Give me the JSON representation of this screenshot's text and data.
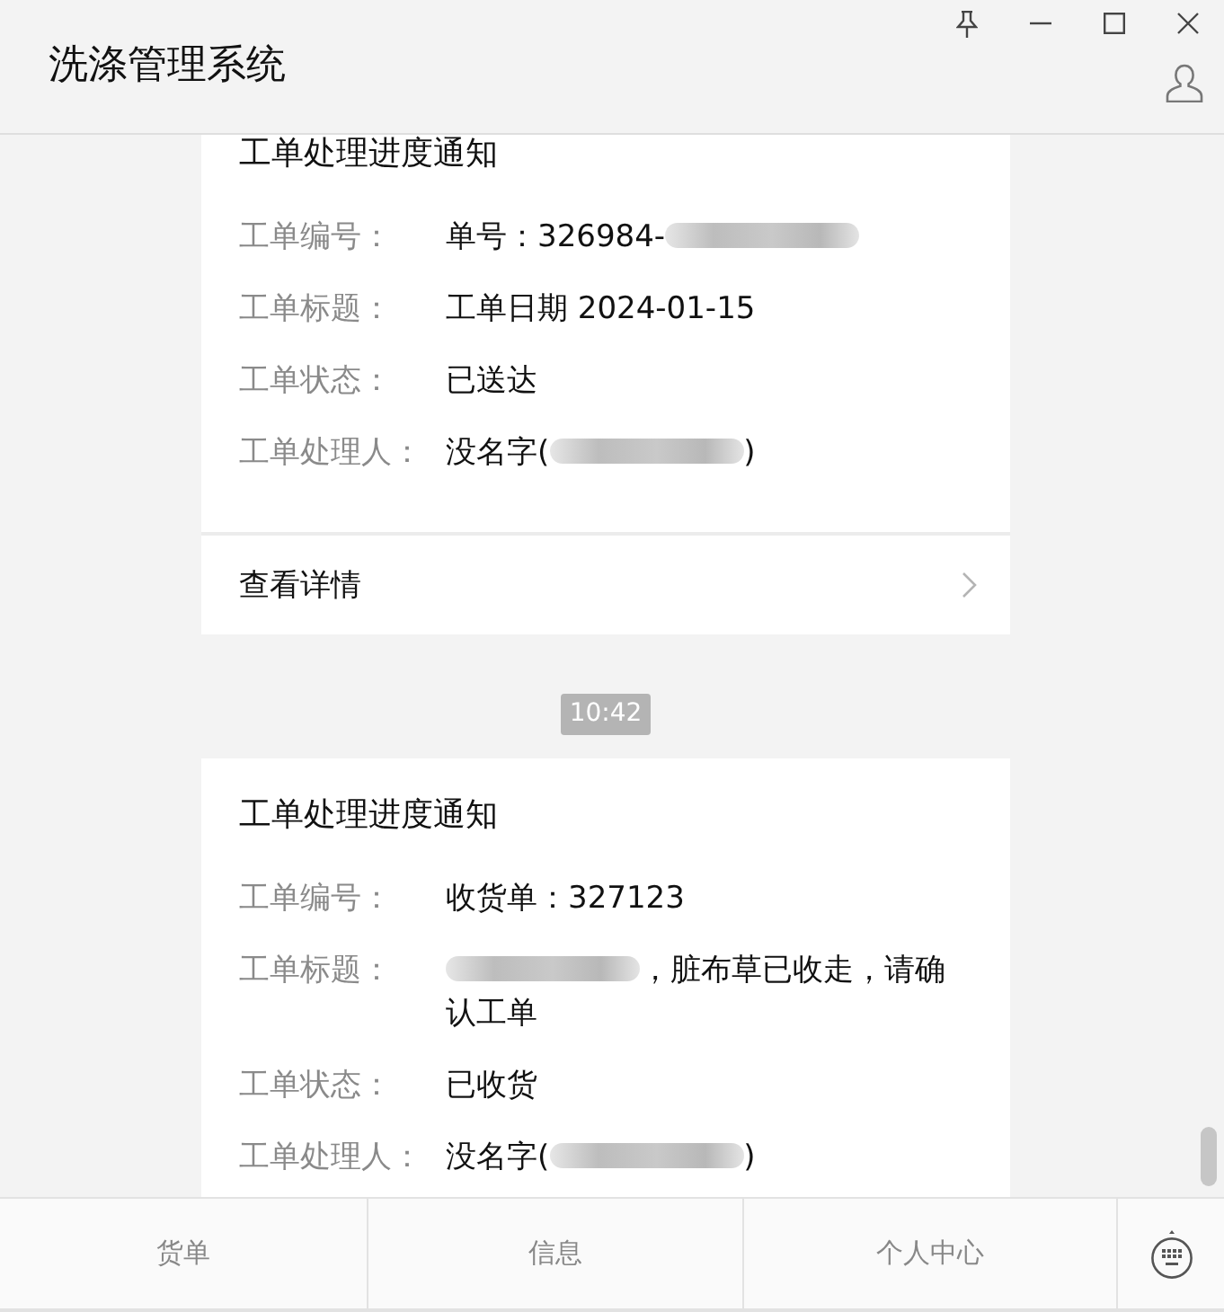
{
  "window": {
    "title": "洗涤管理系统"
  },
  "messages": [
    {
      "kind": "card",
      "title": "工单处理进度通知",
      "fields": [
        {
          "label": "工单编号：",
          "value": [
            {
              "kind": "text",
              "text": "单号：326984-"
            },
            {
              "kind": "redacted"
            }
          ]
        },
        {
          "label": "工单标题：",
          "value": [
            {
              "kind": "text",
              "text": "工单日期 2024-01-15"
            }
          ]
        },
        {
          "label": "工单状态：",
          "value": [
            {
              "kind": "text",
              "text": "已送达"
            }
          ]
        },
        {
          "label": "工单处理人：",
          "value": [
            {
              "kind": "text",
              "text": "没名字("
            },
            {
              "kind": "redacted"
            },
            {
              "kind": "text",
              "text": ")"
            }
          ]
        }
      ],
      "link": "查看详情"
    },
    {
      "kind": "time",
      "text": "10:42"
    },
    {
      "kind": "card",
      "title": "工单处理进度通知",
      "fields": [
        {
          "label": "工单编号：",
          "value": [
            {
              "kind": "text",
              "text": "收货单：327123"
            }
          ]
        },
        {
          "label": "工单标题：",
          "value": [
            {
              "kind": "redacted"
            },
            {
              "kind": "text",
              "text": "，脏布草已收走，请确认工单"
            }
          ]
        },
        {
          "label": "工单状态：",
          "value": [
            {
              "kind": "text",
              "text": "已收货"
            }
          ]
        },
        {
          "label": "工单处理人：",
          "value": [
            {
              "kind": "text",
              "text": "没名字("
            },
            {
              "kind": "redacted"
            },
            {
              "kind": "text",
              "text": ")"
            }
          ]
        }
      ]
    }
  ],
  "menu": [
    {
      "label": "货单"
    },
    {
      "label": "信息"
    },
    {
      "label": "个人中心"
    }
  ]
}
